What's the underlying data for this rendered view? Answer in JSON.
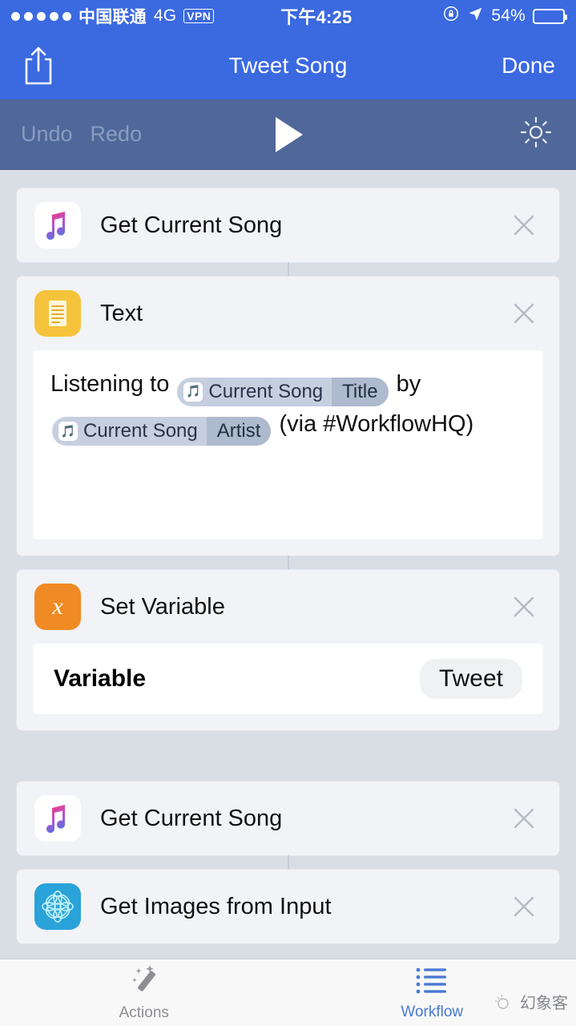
{
  "status_bar": {
    "signal_dots": 5,
    "carrier": "中国联通",
    "network": "4G",
    "vpn_badge": "VPN",
    "time": "下午4:25",
    "rotation_lock_icon": "rotation-lock-icon",
    "location_icon": "location-arrow-icon",
    "battery_percent": "54%",
    "battery_level": 54
  },
  "nav_bar": {
    "share_icon": "share-icon",
    "title": "Tweet Song",
    "done_label": "Done"
  },
  "toolbar": {
    "undo_label": "Undo",
    "redo_label": "Redo",
    "play_icon": "play-icon",
    "settings_icon": "gear-icon"
  },
  "workflow": {
    "actions": [
      {
        "title": "Get Current Song",
        "icon": "apple-music-icon",
        "close_icon": "close-icon",
        "connector_below": true,
        "body": null
      },
      {
        "title": "Text",
        "icon": "text-document-icon",
        "close_icon": "close-icon",
        "connector_below": true,
        "body": {
          "type": "text",
          "segments": [
            {
              "kind": "text",
              "value": "Listening to "
            },
            {
              "kind": "token",
              "icon": "music-note-icon",
              "label": "Current Song",
              "sub": "Title"
            },
            {
              "kind": "text",
              "value": " by "
            },
            {
              "kind": "token",
              "icon": "music-note-icon",
              "label": "Current Song",
              "sub": "Artist"
            },
            {
              "kind": "text",
              "value": " (via #WorkflowHQ)"
            }
          ]
        }
      },
      {
        "title": "Set Variable",
        "icon": "variable-x-icon",
        "close_icon": "close-icon",
        "connector_below": false,
        "body": {
          "type": "field",
          "label": "Variable",
          "value": "Tweet"
        }
      },
      {
        "title": "Get Current Song",
        "icon": "apple-music-icon",
        "close_icon": "close-icon",
        "connector_below": true,
        "body": null
      },
      {
        "title": "Get Images from Input",
        "icon": "mandala-flower-icon",
        "close_icon": "close-icon",
        "connector_below": false,
        "body": null
      }
    ]
  },
  "tab_bar": {
    "tabs": [
      {
        "label": "Actions",
        "icon": "magic-wand-icon",
        "active": false
      },
      {
        "label": "Workflow",
        "icon": "list-icon",
        "active": true
      }
    ]
  },
  "watermark": {
    "text": "幻象客"
  },
  "colors": {
    "nav_blue": "#3b69e0",
    "toolbar_blue": "#4f6799",
    "page_bg": "#d9dee5",
    "card_bg": "#f2f3f7",
    "accent_tab": "#4a79d4",
    "token_bg": "#c6cfe0",
    "token_sub_bg": "#aebace",
    "icon_text_yellow": "#f5c33b",
    "icon_variable_orange": "#f08a24",
    "icon_images_blue": "#29a3d9"
  }
}
